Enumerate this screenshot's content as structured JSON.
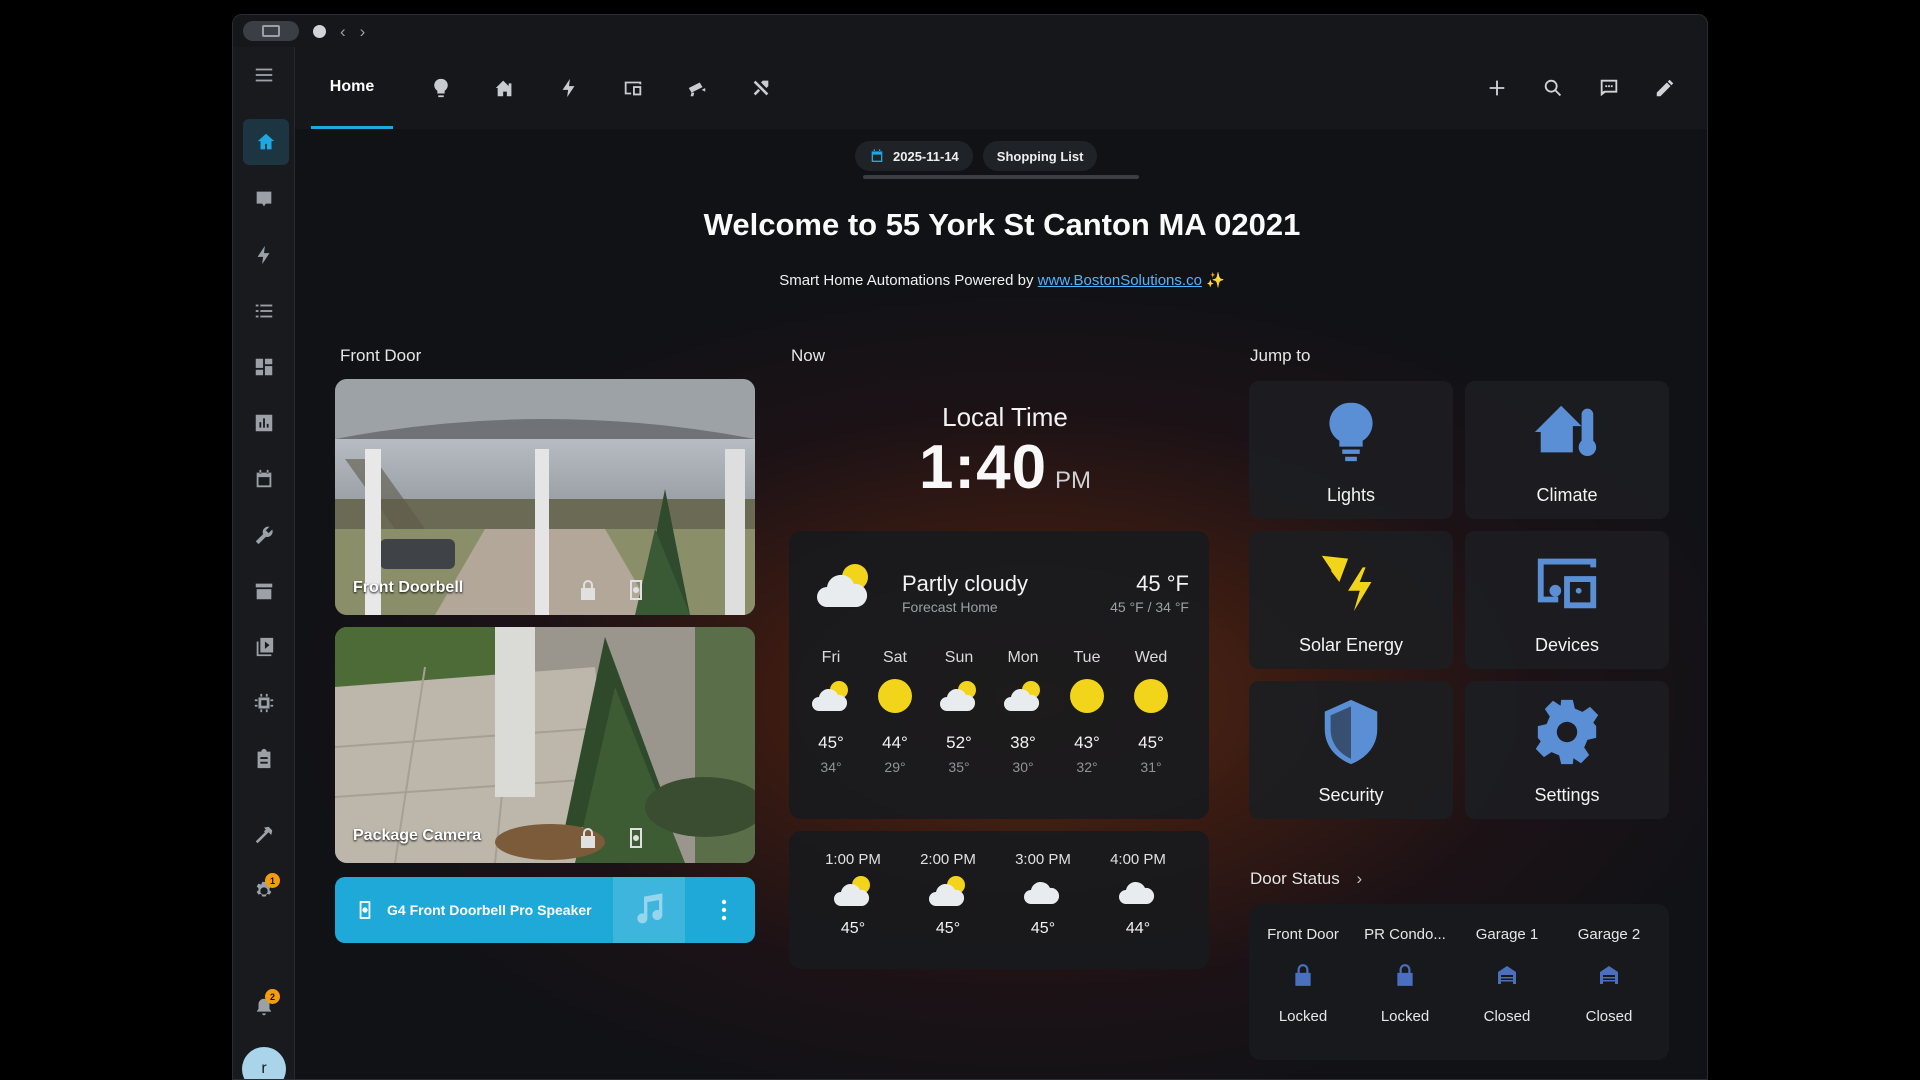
{
  "window": {
    "title_icons": [
      "window-icon",
      "back-icon",
      "forward-icon"
    ]
  },
  "colors": {
    "accent": "#1ea7e1",
    "speaker_bar": "#1fa9d8",
    "sun": "#f2d51a",
    "lock": "#4a6fbf"
  },
  "sidebar": {
    "items": [
      "home-icon",
      "map-icon",
      "energy-icon",
      "logbook-icon",
      "dashboard-icon",
      "history-icon",
      "calendar-icon",
      "wrench-icon",
      "store-icon",
      "media-icon",
      "chip-icon",
      "clipboard-icon",
      "hammer-icon",
      "settings-icon"
    ],
    "settings_badge": "1",
    "notifications_badge": "2",
    "avatar_initial": "r"
  },
  "topbar": {
    "home_tab": "Home",
    "tab_icons": [
      "lightbulb-icon",
      "climate-icon",
      "bolt-icon",
      "devices-icon",
      "security-camera-icon",
      "tools-icon"
    ],
    "right_icons": [
      "plus-icon",
      "search-icon",
      "assist-icon",
      "edit-icon"
    ]
  },
  "chips": {
    "date": "2025-11-14",
    "shopping": "Shopping List"
  },
  "welcome": "Welcome to 55 York St Canton MA 02021",
  "powered": {
    "prefix": "Smart Home Automations Powered by ",
    "link": "www.BostonSolutions.co",
    "suffix": " ✨"
  },
  "front_door": {
    "title": "Front Door",
    "cameras": [
      {
        "label": "Front Doorbell"
      },
      {
        "label": "Package Camera"
      }
    ],
    "speaker": "G4 Front Doorbell Pro Speaker"
  },
  "now": {
    "title": "Now",
    "local_time_label": "Local Time",
    "time": "1:40",
    "ampm": "PM",
    "weather": {
      "condition": "Partly cloudy",
      "source": "Forecast Home",
      "temp": "45 °F",
      "hilo": "45 °F / 34 °F",
      "daily": [
        {
          "day": "Fri",
          "icon": "partly-cloudy",
          "hi": "45°",
          "lo": "34°"
        },
        {
          "day": "Sat",
          "icon": "sunny",
          "hi": "44°",
          "lo": "29°"
        },
        {
          "day": "Sun",
          "icon": "partly-cloudy",
          "hi": "52°",
          "lo": "35°"
        },
        {
          "day": "Mon",
          "icon": "partly-cloudy",
          "hi": "38°",
          "lo": "30°"
        },
        {
          "day": "Tue",
          "icon": "sunny",
          "hi": "43°",
          "lo": "32°"
        },
        {
          "day": "Wed",
          "icon": "sunny",
          "hi": "45°",
          "lo": "31°"
        }
      ],
      "hourly": [
        {
          "time": "1:00 PM",
          "icon": "partly-cloudy",
          "temp": "45°"
        },
        {
          "time": "2:00 PM",
          "icon": "partly-cloudy",
          "temp": "45°"
        },
        {
          "time": "3:00 PM",
          "icon": "cloudy",
          "temp": "45°"
        },
        {
          "time": "4:00 PM",
          "icon": "cloudy",
          "temp": "44°"
        }
      ]
    }
  },
  "jump": {
    "title": "Jump to",
    "tiles": [
      {
        "label": "Lights",
        "icon": "lightbulb-icon"
      },
      {
        "label": "Climate",
        "icon": "home-thermometer-icon"
      },
      {
        "label": "Solar Energy",
        "icon": "solar-power-icon"
      },
      {
        "label": "Devices",
        "icon": "devices-icon"
      },
      {
        "label": "Security",
        "icon": "shield-icon"
      },
      {
        "label": "Settings",
        "icon": "gear-icon"
      }
    ]
  },
  "doors": {
    "title": "Door Status",
    "chevron": "›",
    "items": [
      {
        "name": "Front Door",
        "status": "Locked",
        "icon": "lock-icon"
      },
      {
        "name": "PR Condo...",
        "status": "Locked",
        "icon": "lock-icon"
      },
      {
        "name": "Garage 1",
        "status": "Closed",
        "icon": "garage-icon"
      },
      {
        "name": "Garage 2",
        "status": "Closed",
        "icon": "garage-icon"
      }
    ]
  }
}
